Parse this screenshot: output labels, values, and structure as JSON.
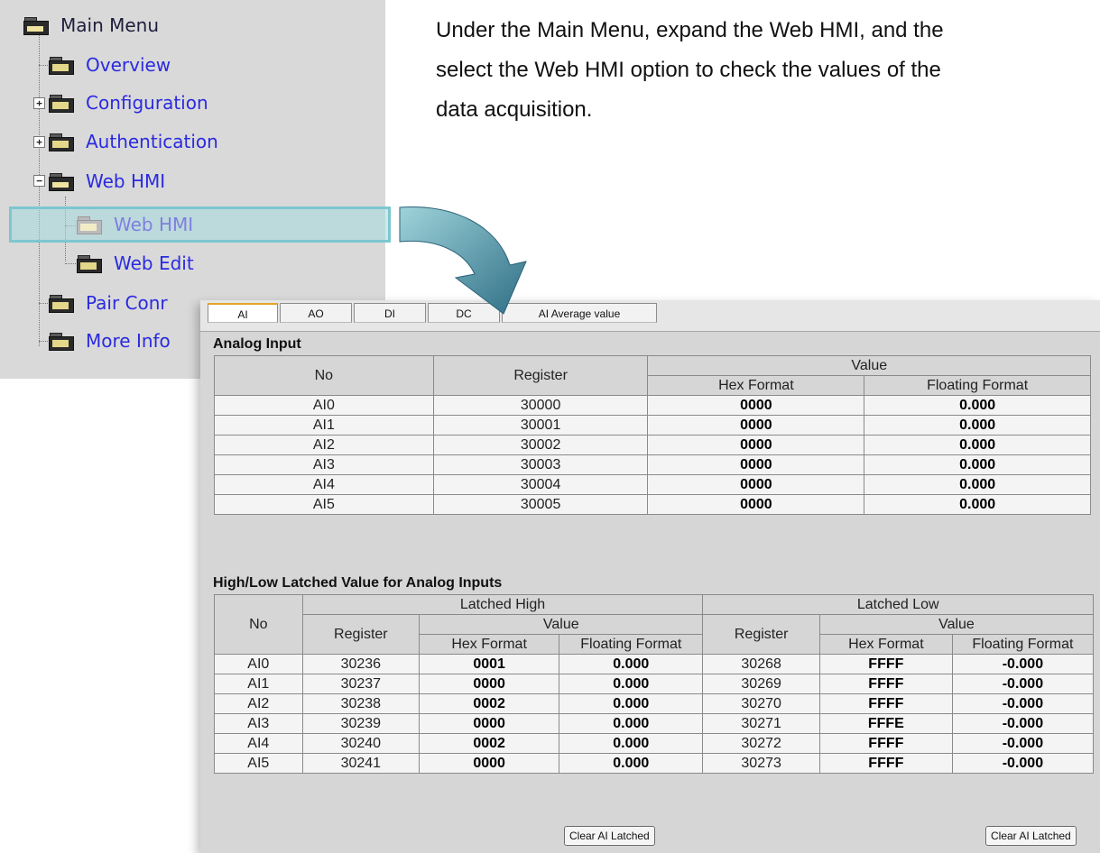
{
  "tree_menu": {
    "items": [
      {
        "label": "Main Menu"
      },
      {
        "label": "Overview"
      },
      {
        "label": "Configuration"
      },
      {
        "label": "Authentication"
      },
      {
        "label": "Web HMI"
      },
      {
        "label": "Web HMI"
      },
      {
        "label": "Web Edit"
      },
      {
        "label": "Pair Conr"
      },
      {
        "label": "More Info"
      }
    ],
    "expand_glyph": "+",
    "collapse_glyph": "−"
  },
  "instruction": "Under the Main Menu, expand the Web HMI, and the\nselect the Web HMI option to check the values of the\ndata acquisition.",
  "tabs": [
    "AI",
    "AO",
    "DI",
    "DC",
    "AI Average value"
  ],
  "analog_input": {
    "title": "Analog Input",
    "headers": {
      "no": "No",
      "register": "Register",
      "value": "Value",
      "hex": "Hex Format",
      "float": "Floating Format"
    },
    "rows": [
      {
        "no": "AI0",
        "register": "30000",
        "hex": "0000",
        "float": "0.000"
      },
      {
        "no": "AI1",
        "register": "30001",
        "hex": "0000",
        "float": "0.000"
      },
      {
        "no": "AI2",
        "register": "30002",
        "hex": "0000",
        "float": "0.000"
      },
      {
        "no": "AI3",
        "register": "30003",
        "hex": "0000",
        "float": "0.000"
      },
      {
        "no": "AI4",
        "register": "30004",
        "hex": "0000",
        "float": "0.000"
      },
      {
        "no": "AI5",
        "register": "30005",
        "hex": "0000",
        "float": "0.000"
      }
    ]
  },
  "latched": {
    "title": "High/Low Latched Value for Analog Inputs",
    "headers": {
      "no": "No",
      "high": "Latched High",
      "low": "Latched Low",
      "register": "Register",
      "value": "Value",
      "hex": "Hex Format",
      "float": "Floating Format"
    },
    "rows": [
      {
        "no": "AI0",
        "h_reg": "30236",
        "h_hex": "0001",
        "h_float": "0.000",
        "l_reg": "30268",
        "l_hex": "FFFF",
        "l_float": "-0.000"
      },
      {
        "no": "AI1",
        "h_reg": "30237",
        "h_hex": "0000",
        "h_float": "0.000",
        "l_reg": "30269",
        "l_hex": "FFFF",
        "l_float": "-0.000"
      },
      {
        "no": "AI2",
        "h_reg": "30238",
        "h_hex": "0002",
        "h_float": "0.000",
        "l_reg": "30270",
        "l_hex": "FFFF",
        "l_float": "-0.000"
      },
      {
        "no": "AI3",
        "h_reg": "30239",
        "h_hex": "0000",
        "h_float": "0.000",
        "l_reg": "30271",
        "l_hex": "FFFE",
        "l_float": "-0.000"
      },
      {
        "no": "AI4",
        "h_reg": "30240",
        "h_hex": "0002",
        "h_float": "0.000",
        "l_reg": "30272",
        "l_hex": "FFFF",
        "l_float": "-0.000"
      },
      {
        "no": "AI5",
        "h_reg": "30241",
        "h_hex": "0000",
        "h_float": "0.000",
        "l_reg": "30273",
        "l_hex": "FFFF",
        "l_float": "-0.000"
      }
    ],
    "clear_high_label": "Clear AI Latched",
    "clear_low_label": "Clear AI Latched"
  },
  "colors": {
    "arrow_start": "#9fd3da",
    "arrow_end": "#2f6f86",
    "highlight": "#a4d9df",
    "active_tab_accent": "#e5a428"
  }
}
